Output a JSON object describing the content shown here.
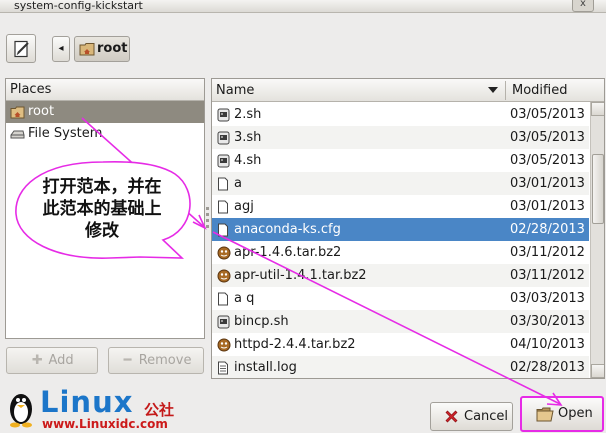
{
  "window": {
    "title": "system-config-kickstart",
    "close_glyph": "x"
  },
  "path_bar": {
    "back_glyph": "◂",
    "current_folder": "root"
  },
  "places": {
    "header": "Places",
    "items": [
      {
        "label": "root",
        "icon": "home-folder-icon",
        "selected": true
      },
      {
        "label": "File System",
        "icon": "drive-icon",
        "selected": false
      }
    ],
    "add_label": "Add",
    "remove_label": "Remove",
    "add_glyph": "✚",
    "remove_glyph": "━"
  },
  "files": {
    "col_name": "Name",
    "col_modified": "Modified",
    "rows": [
      {
        "name": "2.sh",
        "modified": "03/05/2013",
        "icon": "script",
        "selected": false
      },
      {
        "name": "3.sh",
        "modified": "03/05/2013",
        "icon": "script",
        "selected": false
      },
      {
        "name": "4.sh",
        "modified": "03/05/2013",
        "icon": "script",
        "selected": false
      },
      {
        "name": "a",
        "modified": "03/01/2013",
        "icon": "doc",
        "selected": false
      },
      {
        "name": "agj",
        "modified": "03/01/2013",
        "icon": "doc",
        "selected": false
      },
      {
        "name": "anaconda-ks.cfg",
        "modified": "02/28/2013",
        "icon": "doc",
        "selected": true
      },
      {
        "name": "apr-1.4.6.tar.bz2",
        "modified": "03/11/2012",
        "icon": "archive",
        "selected": false
      },
      {
        "name": "apr-util-1.4.1.tar.bz2",
        "modified": "03/11/2012",
        "icon": "archive",
        "selected": false
      },
      {
        "name": "a q",
        "modified": "03/03/2013",
        "icon": "doc",
        "selected": false
      },
      {
        "name": "bincp.sh",
        "modified": "03/30/2013",
        "icon": "script",
        "selected": false
      },
      {
        "name": "httpd-2.4.4.tar.bz2",
        "modified": "04/10/2013",
        "icon": "archive",
        "selected": false
      },
      {
        "name": "install.log",
        "modified": "02/28/2013",
        "icon": "text",
        "selected": false
      }
    ]
  },
  "actions": {
    "cancel_label": "Cancel",
    "open_label": "Open"
  },
  "annotation": {
    "callout_line1": "打开范本，并在",
    "callout_line2": "此范本的基础上",
    "callout_line3": "修改",
    "arrow_color": "#e62be6"
  },
  "watermark": {
    "brand": "Linux",
    "brand_cn": "公社",
    "url": "www.Linuxidc.com"
  }
}
